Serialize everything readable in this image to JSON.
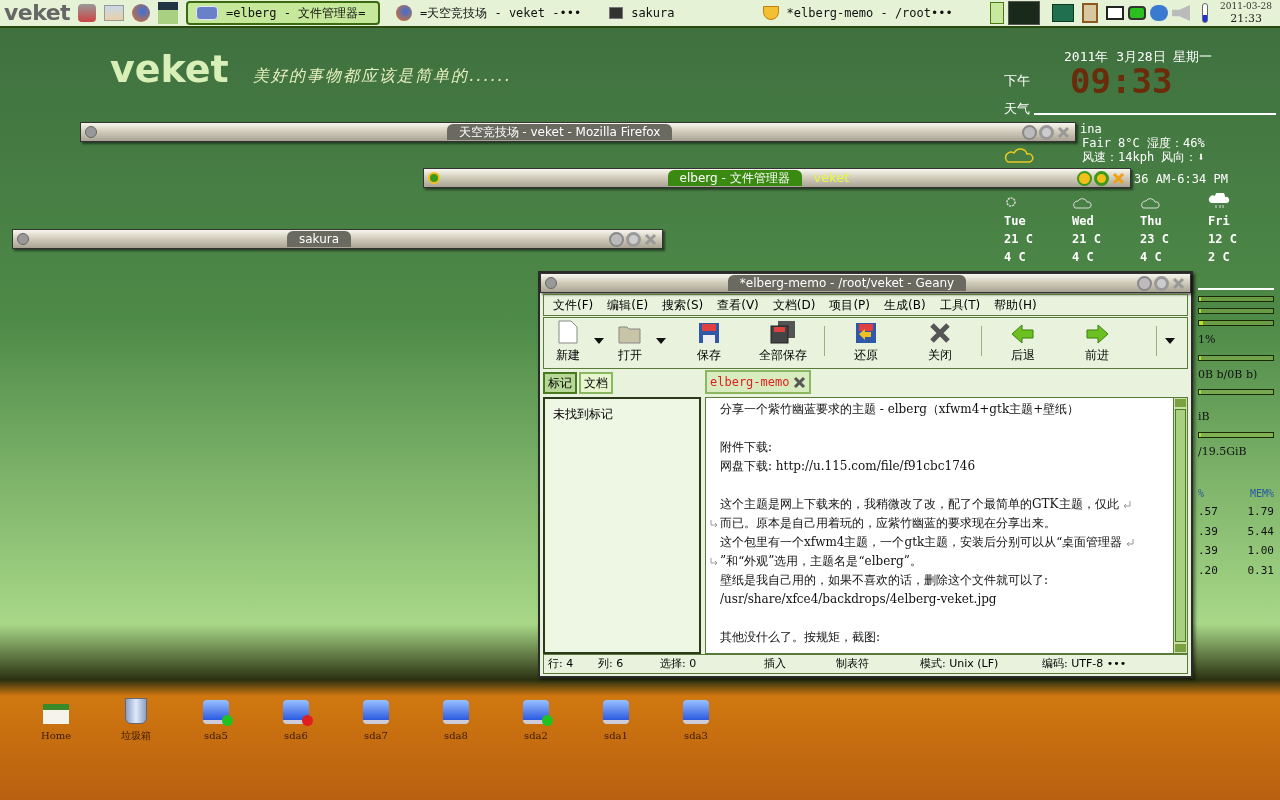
{
  "taskbar": {
    "logo": "veket",
    "tasks": [
      {
        "label": "=elberg - 文件管理器=",
        "selected": true,
        "kind": "folder"
      },
      {
        "label": "=天空竞技场 - veket -•••",
        "selected": false,
        "kind": "browser"
      },
      {
        "label": "sakura",
        "selected": false,
        "kind": "terminal"
      },
      {
        "label": "*elberg-memo - /root•••",
        "selected": false,
        "kind": "editor"
      }
    ],
    "date": "2011-03-28",
    "time": "21:33"
  },
  "desktop": {
    "logo": "veket",
    "slogan": "美好的事物都应该是简单的......",
    "icons": [
      {
        "label": "Home",
        "kind": "home"
      },
      {
        "label": "垃圾箱",
        "kind": "trash"
      },
      {
        "label": "sda5",
        "kind": "drive",
        "color": "#22c020"
      },
      {
        "label": "sda6",
        "kind": "drive",
        "color": "#e02020"
      },
      {
        "label": "sda7",
        "kind": "drive"
      },
      {
        "label": "sda8",
        "kind": "drive"
      },
      {
        "label": "sda2",
        "kind": "drive",
        "color": "#22c020"
      },
      {
        "label": "sda1",
        "kind": "drive"
      },
      {
        "label": "sda3",
        "kind": "drive"
      }
    ]
  },
  "conky": {
    "date": "2011年 3月28日 星期一",
    "ampm": "下午",
    "clock": "09:33",
    "weather_title": "天气",
    "location": "ina",
    "conditions": "Fair  8°C 湿度：46%",
    "wind": "风速：14kph 风向：⬇",
    "sun": "36 AM-6:34 PM",
    "forecast": [
      {
        "day": "Tue",
        "high": "21 C",
        "low": "4 C",
        "kind": "sun"
      },
      {
        "day": "Wed",
        "high": "21 C",
        "low": "4 C",
        "kind": "cloud"
      },
      {
        "day": "Thu",
        "high": "23 C",
        "low": "4 C",
        "kind": "cloud"
      },
      {
        "day": "Fri",
        "high": "12 C",
        "low": "2 C",
        "kind": "rain"
      }
    ],
    "bars": [
      {
        "level": 0.0
      },
      {
        "level": 0.0
      },
      {
        "level": 0.05
      }
    ],
    "cpu_line": "1%",
    "cpu_bar": {
      "level": 0.0
    },
    "net": "0B  b/0B  b)",
    "net_bar": {
      "level": 0.0
    },
    "disk": "iB",
    "disk_bar": {
      "level": 0.0
    },
    "disk_total": "/19.5GiB",
    "columns": [
      "%",
      "MEM%"
    ],
    "rows": [
      [
        ".57",
        "1.79"
      ],
      [
        ".39",
        "5.44"
      ],
      [
        ".39",
        "1.00"
      ],
      [
        ".20",
        "0.31"
      ]
    ]
  },
  "shaded_windows": [
    {
      "title": "天空竞技场 - veket - Mozilla Firefox",
      "active": false
    },
    {
      "title": "elberg - 文件管理器",
      "active": true,
      "extra": "veket"
    },
    {
      "title": "sakura",
      "active": false
    }
  ],
  "editor": {
    "title": "*elberg-memo - /root/veket - Geany",
    "menu": [
      "文件(F)",
      "编辑(E)",
      "搜索(S)",
      "查看(V)",
      "文档(D)",
      "项目(P)",
      "生成(B)",
      "工具(T)",
      "帮助(H)"
    ],
    "toolbar": [
      {
        "label": "新建",
        "kind": "new",
        "dropdown": true
      },
      {
        "label": "打开",
        "kind": "open",
        "dropdown": true
      },
      {
        "label": "保存",
        "kind": "save",
        "dropdown": false
      },
      {
        "label": "全部保存",
        "kind": "saveall",
        "dropdown": false
      },
      {
        "label": "还原",
        "kind": "revert",
        "dropdown": false
      },
      {
        "label": "关闭",
        "kind": "close",
        "dropdown": false
      },
      {
        "label": "后退",
        "kind": "back",
        "dropdown": false
      },
      {
        "label": "前进",
        "kind": "forward",
        "dropdown": false
      }
    ],
    "side_tabs": [
      {
        "label": "标记",
        "selected": true
      },
      {
        "label": "文档",
        "selected": false
      }
    ],
    "side_text": "未找到标记",
    "doc_tab": "elberg-memo",
    "lines": [
      {
        "text": "分享一个紫竹幽蓝要求的主题 - elberg（xfwm4+gtk主题+壁纸）"
      },
      {
        "kind": "blank"
      },
      {
        "text": "附件下载:"
      },
      {
        "text": "网盘下载:  http://u.115.com/file/f91cbc1746"
      },
      {
        "kind": "blank"
      },
      {
        "text": "这个主题是网上下载来的，我稍微改了改，配了个最简单的GTK主题，仅此",
        "wraps": true
      },
      {
        "text": "而已。原本是自己用着玩的，应紫竹幽蓝的要求现在分享出来。",
        "continued": true
      },
      {
        "text": "这个包里有一个xfwm4主题，一个gtk主题，安装后分别可以从“桌面管理器",
        "wraps": true
      },
      {
        "text": "”和“外观”选用，主题名是“elberg”。",
        "continued": true
      },
      {
        "text": "壁纸是我自己用的，如果不喜欢的话，删除这个文件就可以了:"
      },
      {
        "text": "/usr/share/xfce4/backdrops/4elberg-veket.jpg"
      },
      {
        "kind": "blank"
      },
      {
        "text": "其他没什么了。按规矩，截图:"
      }
    ],
    "status": [
      "行: 4",
      "列: 6",
      "选择: 0",
      "插入",
      "制表符",
      "模式: Unix (LF)",
      "编码: UTF-8 •••"
    ]
  }
}
